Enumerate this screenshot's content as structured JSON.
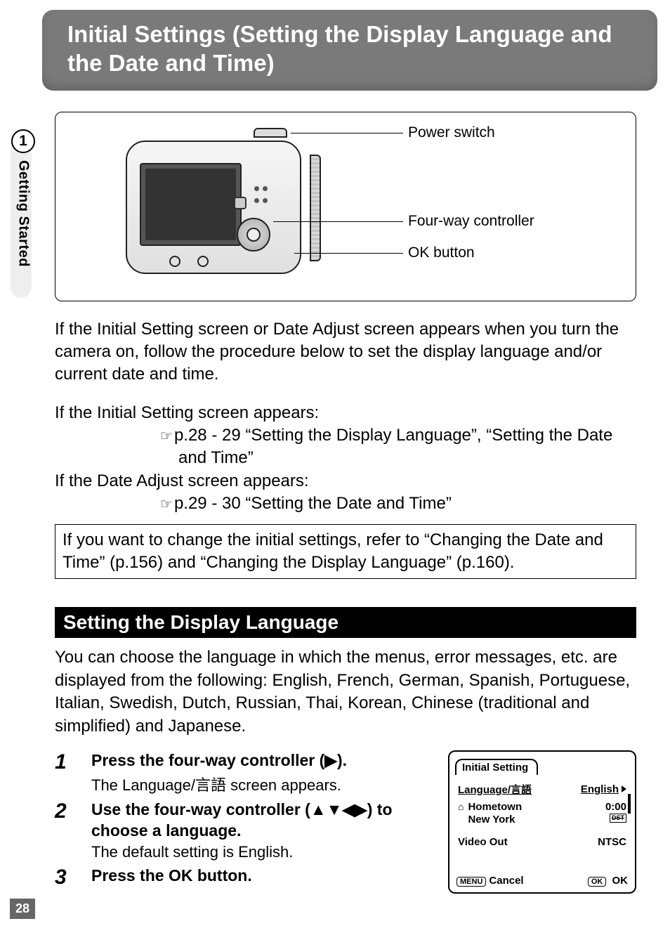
{
  "header": {
    "title": "Initial Settings (Setting the Display Language and the Date and Time)"
  },
  "sideTab": {
    "number": "1",
    "label": "Getting Started"
  },
  "diagram": {
    "callouts": {
      "power": "Power switch",
      "fourway": "Four-way controller",
      "ok": "OK button"
    }
  },
  "intro": {
    "p1": "If the Initial Setting screen or Date Adjust screen appears when you turn the camera on, follow the procedure below to set the display language and/or current date and time.",
    "if1": "If the Initial Setting screen appears:",
    "ref1": "p.28 - 29 “Setting the Display Language”, “Setting the Date and Time”",
    "if2": "If the Date Adjust screen appears:",
    "ref2": "p.29 - 30 “Setting the Date and Time”",
    "note": "If you want to change the initial settings, refer to “Changing the Date and Time” (p.156) and “Changing the Display Language” (p.160)."
  },
  "section": {
    "title": "Setting the Display Language",
    "p": "You can choose the language in which the menus, error messages, etc. are displayed from the following: English, French, German, Spanish, Portuguese, Italian, Swedish, Dutch, Russian, Thai, Korean, Chinese (traditional and simplified) and Japanese."
  },
  "steps": {
    "s1": {
      "num": "1",
      "title": "Press the four-way controller (▶).",
      "sub": "The Language/言語  screen appears."
    },
    "s2": {
      "num": "2",
      "title": "Use the four-way controller (▲▼◀▶) to choose a language.",
      "sub": "The default setting is English."
    },
    "s3": {
      "num": "3",
      "title": "Press the OK button."
    }
  },
  "lcd": {
    "tab": "Initial Setting",
    "langLabel": "Language/言語",
    "langValue": "English",
    "homeLabel": "Hometown",
    "homeCity": "New York",
    "homeTime": "0:00",
    "dst": "DST",
    "videoLabel": "Video Out",
    "videoValue": "NTSC",
    "menuBtn": "MENU",
    "cancel": "Cancel",
    "okBtn": "OK",
    "ok": "OK"
  },
  "pageNumber": "28"
}
